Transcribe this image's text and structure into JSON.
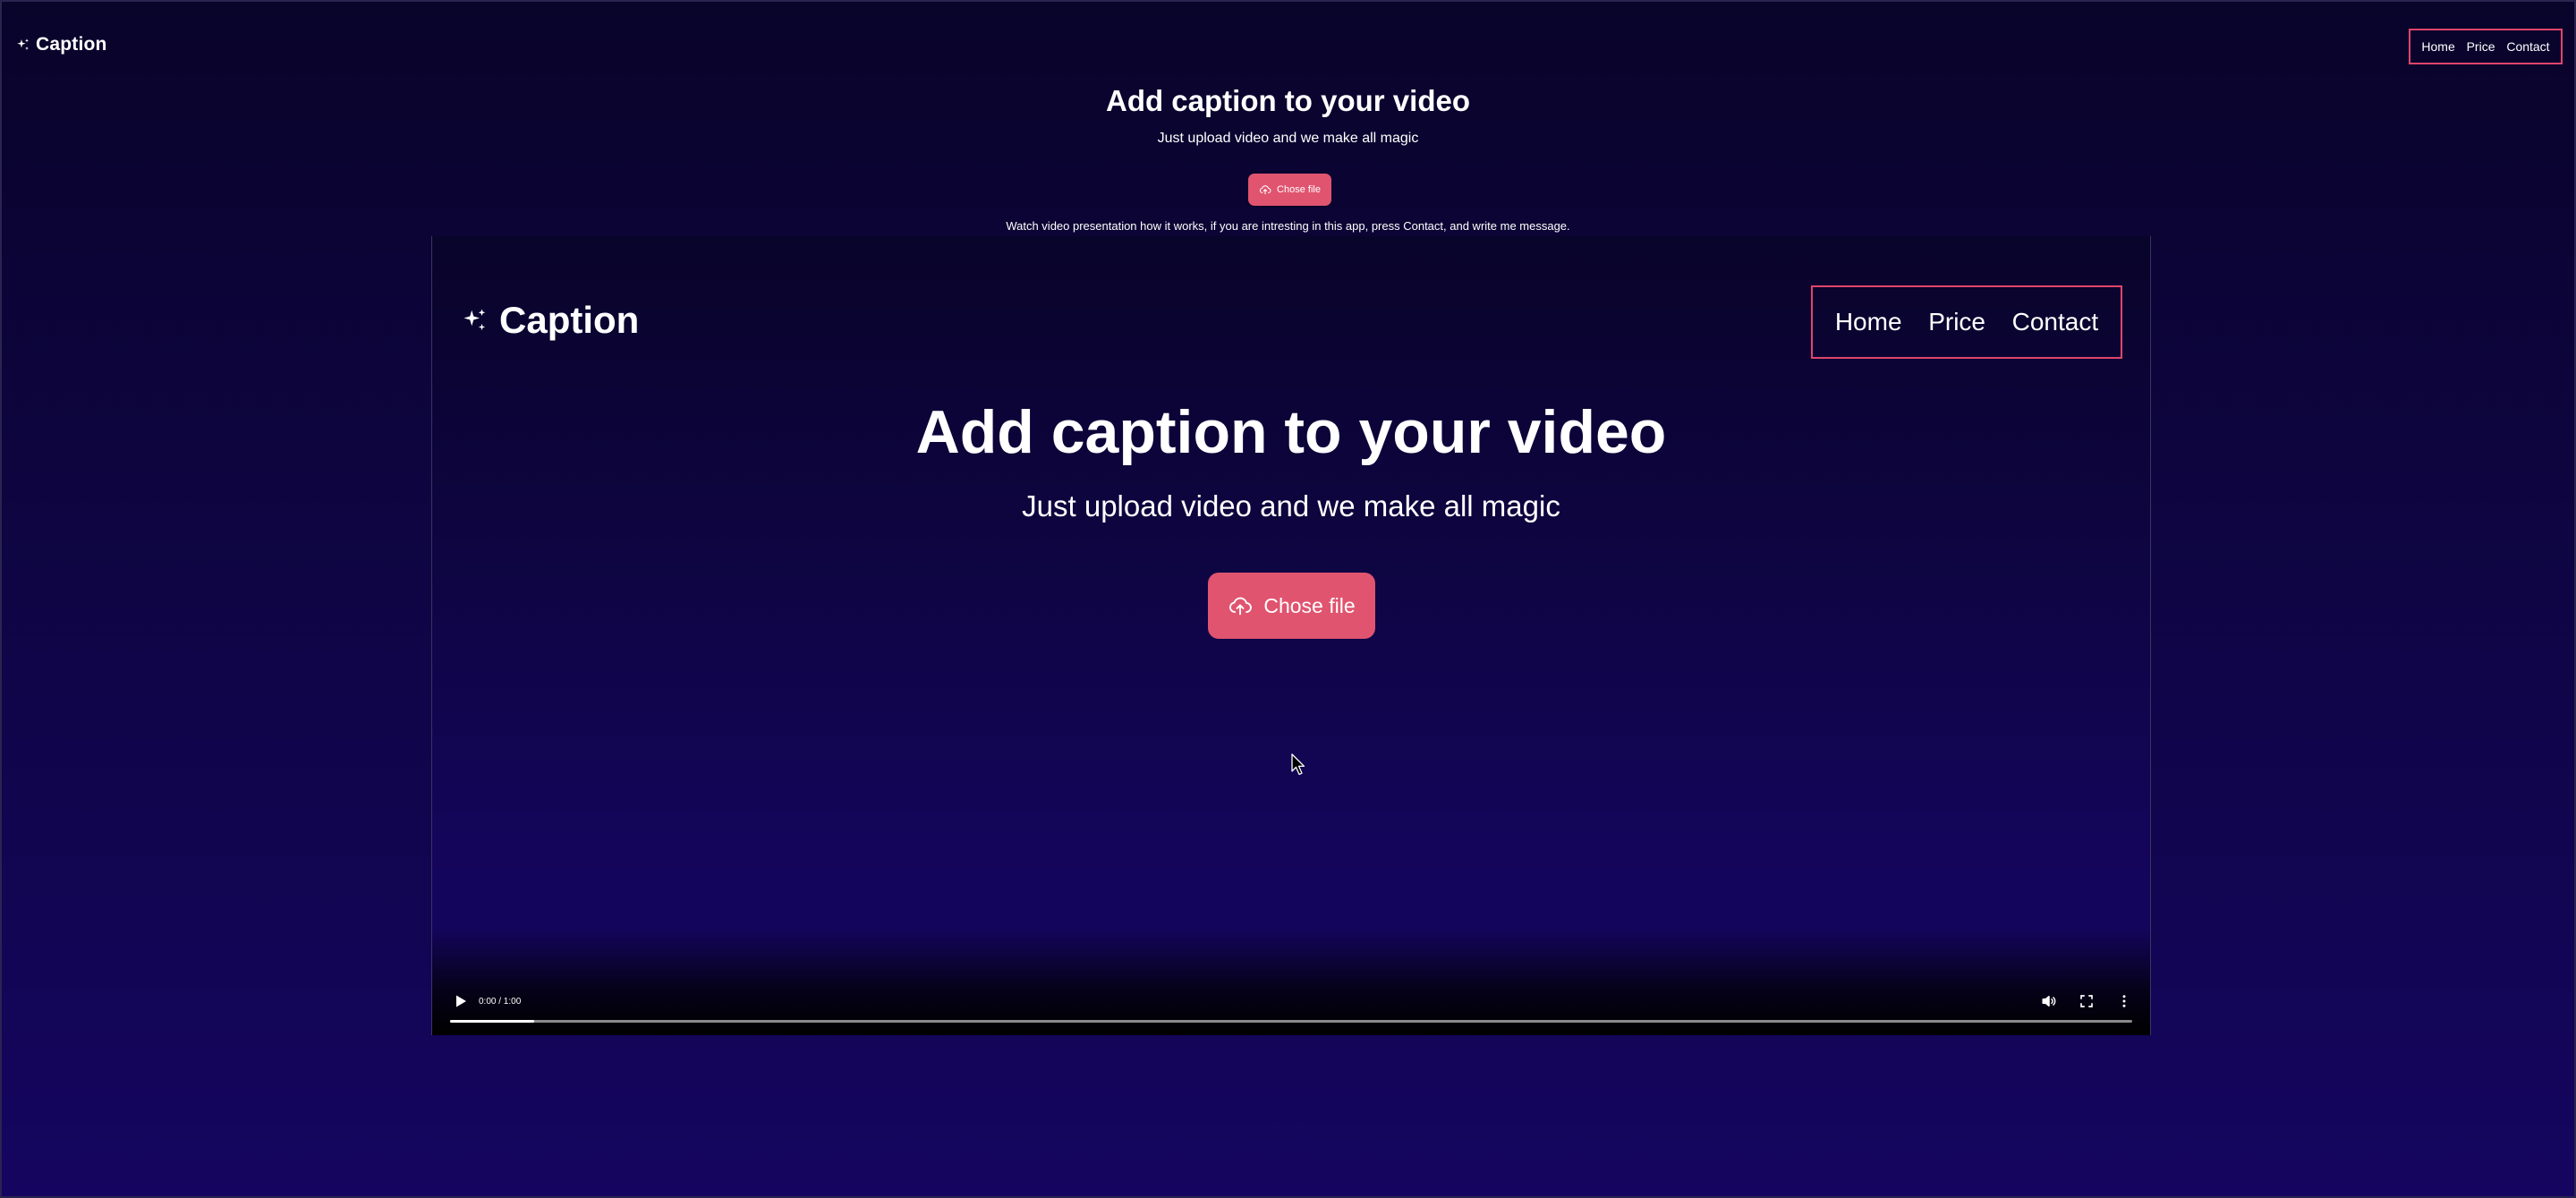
{
  "header": {
    "logo_text": "Caption",
    "logo_icon": "sparkles-icon",
    "nav": [
      "Home",
      "Price",
      "Contact"
    ]
  },
  "hero": {
    "title": "Add caption to your video",
    "subtitle": "Just upload video and we make all magic",
    "button_label": "Chose file",
    "button_icon": "cloud-upload-icon",
    "note": "Watch video presentation how it works, if you are intresting in this app, press Contact, and write me message."
  },
  "video": {
    "frame": {
      "logo_text": "Caption",
      "nav": [
        "Home",
        "Price",
        "Contact"
      ],
      "title": "Add caption to your video",
      "subtitle": "Just upload video and we make all magic",
      "button_label": "Chose file"
    },
    "controls": {
      "time": "0:00 / 1:00",
      "progress": 0.05,
      "icons": [
        "play-icon",
        "volume-icon",
        "fullscreen-icon",
        "more-options-icon"
      ]
    }
  },
  "colors": {
    "accent": "#e0546f",
    "nav_border": "#e0456b",
    "background_top": "#09042a",
    "background_bottom": "#150560"
  }
}
